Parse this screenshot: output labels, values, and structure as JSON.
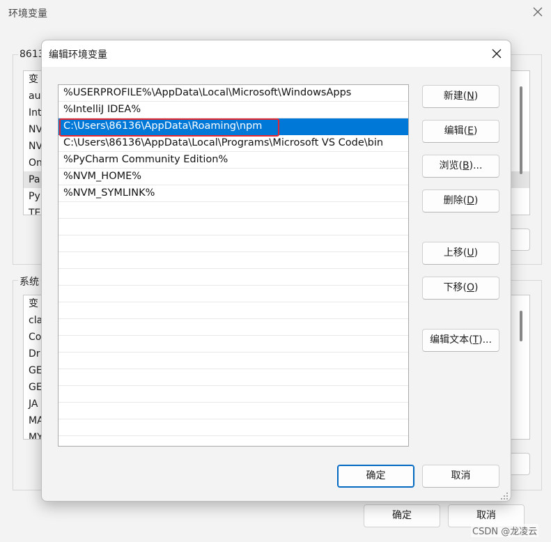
{
  "background_window": {
    "title": "环境变量",
    "user_group_label": "8613",
    "user_rows": [
      "变",
      "au",
      "Int",
      "NV",
      "NV",
      "On",
      "Pa",
      "Py",
      "TE"
    ],
    "system_group_label": "系统",
    "system_rows": [
      "变",
      "cla",
      "Co",
      "Dr",
      "GE",
      "GE",
      "JA",
      "MA",
      "MY"
    ],
    "ok_label": "确定",
    "cancel_label": "取消"
  },
  "dialog": {
    "title": "编辑环境变量",
    "paths": [
      "%USERPROFILE%\\AppData\\Local\\Microsoft\\WindowsApps",
      "%IntelliJ IDEA%",
      "C:\\Users\\86136\\AppData\\Roaming\\npm",
      "C:\\Users\\86136\\AppData\\Local\\Programs\\Microsoft VS Code\\bin",
      "%PyCharm Community Edition%",
      "%NVM_HOME%",
      "%NVM_SYMLINK%"
    ],
    "selected_index": 2,
    "buttons": {
      "new": {
        "label": "新建(",
        "key": "N",
        "suffix": ")"
      },
      "edit": {
        "label": "编辑(",
        "key": "E",
        "suffix": ")"
      },
      "browse": {
        "label": "浏览(",
        "key": "B",
        "suffix": ")..."
      },
      "delete": {
        "label": "删除(",
        "key": "D",
        "suffix": ")"
      },
      "move_up": {
        "label": "上移(",
        "key": "U",
        "suffix": ")"
      },
      "move_down": {
        "label": "下移(",
        "key": "O",
        "suffix": ")"
      },
      "edit_text": {
        "label": "编辑文本(",
        "key": "T",
        "suffix": ")..."
      }
    },
    "ok_label": "确定",
    "cancel_label": "取消"
  },
  "colors": {
    "selection": "#0078d7",
    "highlight_box": "#e8262e",
    "default_button_border": "#0067c0"
  },
  "watermark": "CSDN @龙凌云"
}
